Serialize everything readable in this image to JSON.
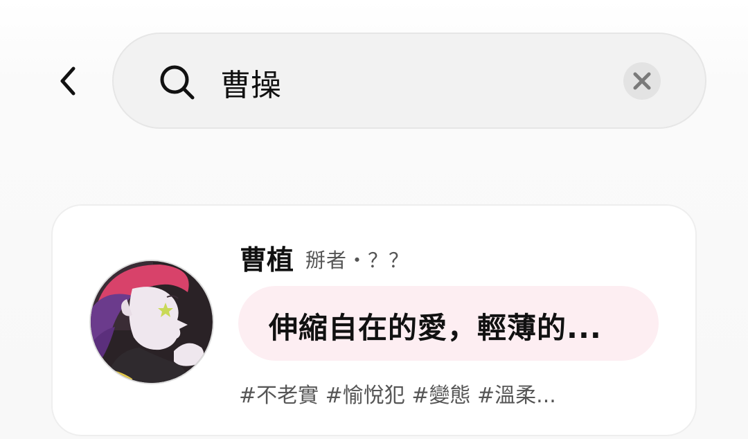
{
  "search": {
    "query": "曹操",
    "placeholder": ""
  },
  "icons": {
    "back": "chevron-left-icon",
    "search": "search-icon",
    "clear": "close-icon"
  },
  "result": {
    "name": "曹植",
    "meta": "掰者・？？",
    "intro": "伸縮自在的愛，輕薄的...",
    "tags": "#不老實 #愉悅犯 #變態 #溫柔..."
  },
  "colors": {
    "intro_bubble": "#fdeef2",
    "search_bg": "#f2f2f2"
  }
}
